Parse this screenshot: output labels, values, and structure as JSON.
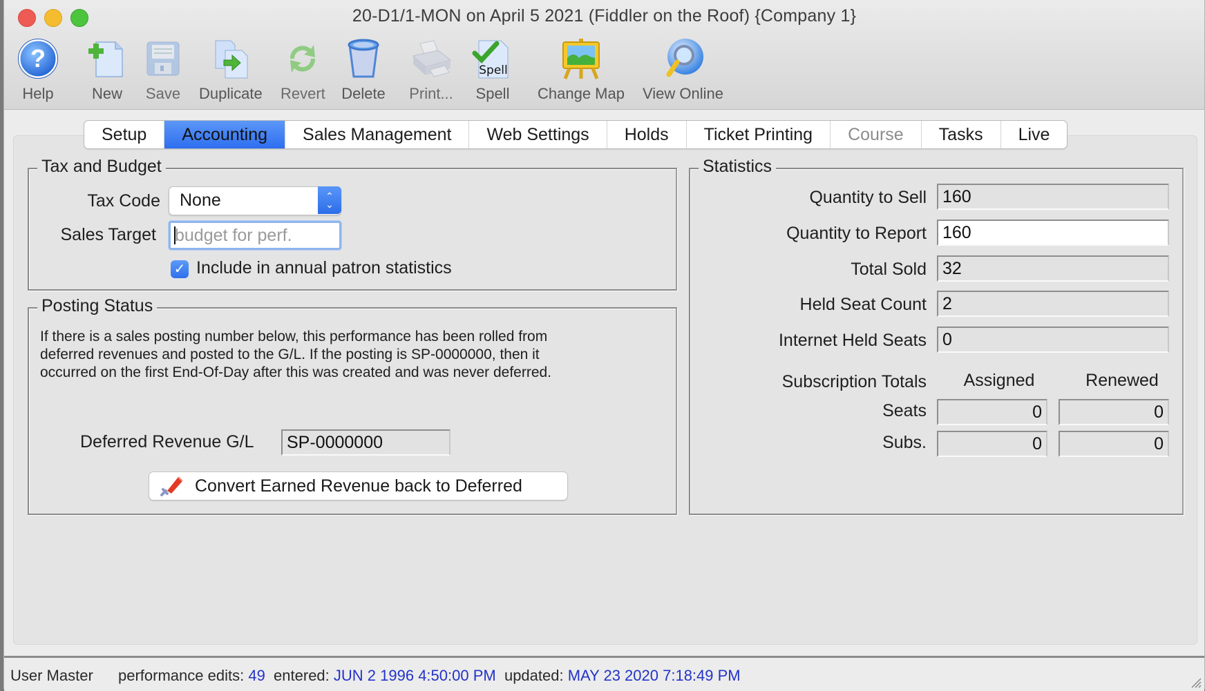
{
  "window": {
    "title": "20-D1/1-MON on April 5 2021 (Fiddler on the Roof) {Company 1}"
  },
  "toolbar": {
    "help": {
      "label": "Help",
      "icon": "help-icon"
    },
    "new": {
      "label": "New",
      "icon": "new-document-icon"
    },
    "save": {
      "label": "Save",
      "icon": "save-disk-icon"
    },
    "duplicate": {
      "label": "Duplicate",
      "icon": "duplicate-icon"
    },
    "revert": {
      "label": "Revert",
      "icon": "revert-arrows-icon"
    },
    "delete": {
      "label": "Delete",
      "icon": "trash-bin-icon"
    },
    "print": {
      "label": "Print...",
      "icon": "printer-icon"
    },
    "spell": {
      "label": "Spell",
      "icon": "spell-check-icon",
      "icon_text": "Spell"
    },
    "change_map": {
      "label": "Change Map",
      "icon": "easel-map-icon"
    },
    "view_online": {
      "label": "View Online",
      "icon": "web-search-icon"
    }
  },
  "tabs": [
    {
      "label": "Setup",
      "state": "normal"
    },
    {
      "label": "Accounting",
      "state": "active"
    },
    {
      "label": "Sales Management",
      "state": "normal"
    },
    {
      "label": "Web Settings",
      "state": "normal"
    },
    {
      "label": "Holds",
      "state": "normal"
    },
    {
      "label": "Ticket Printing",
      "state": "normal"
    },
    {
      "label": "Course",
      "state": "disabled"
    },
    {
      "label": "Tasks",
      "state": "normal"
    },
    {
      "label": "Live",
      "state": "normal"
    }
  ],
  "tax_budget": {
    "title": "Tax and Budget",
    "tax_code_label": "Tax Code",
    "tax_code_value": "None",
    "sales_target_label": "Sales Target",
    "sales_target_value": "",
    "sales_target_placeholder": "budget for perf.",
    "include_stats_label": "Include in annual patron statistics",
    "include_stats_checked": true
  },
  "posting_status": {
    "title": "Posting Status",
    "description_lines": [
      "If there is a sales posting number below, this performance has been rolled from",
      "deferred revenues and posted to the G/L.  If the posting is SP-0000000, then it",
      "occurred on the first End-Of-Day after this was created and was never deferred."
    ],
    "deferred_gl_label": "Deferred Revenue G/L",
    "deferred_gl_value": "SP-0000000",
    "convert_button_label": "Convert Earned Revenue back to Deferred"
  },
  "statistics": {
    "title": "Statistics",
    "rows": [
      {
        "label": "Quantity to Sell",
        "value": "160",
        "editable": false
      },
      {
        "label": "Quantity to Report",
        "value": "160",
        "editable": true
      },
      {
        "label": "Total Sold",
        "value": "32",
        "editable": false
      },
      {
        "label": "Held Seat Count",
        "value": "2",
        "editable": false
      },
      {
        "label": "Internet Held Seats",
        "value": "0",
        "editable": false
      }
    ],
    "subscription": {
      "title": "Subscription Totals",
      "col_assigned": "Assigned",
      "col_renewed": "Renewed",
      "seats_label": "Seats",
      "seats_assigned": "0",
      "seats_renewed": "0",
      "subs_label": "Subs.",
      "subs_assigned": "0",
      "subs_renewed": "0"
    }
  },
  "statusbar": {
    "user": "User Master",
    "edits_label": "performance edits:",
    "edits_value": "49",
    "entered_label": "entered:",
    "entered_value": "JUN 2 1996 4:50:00 PM",
    "updated_label": "updated:",
    "updated_value": "MAY 23 2020 7:18:49 PM"
  },
  "colors": {
    "accent": "#2f70ec",
    "link_value": "#2333c8"
  }
}
